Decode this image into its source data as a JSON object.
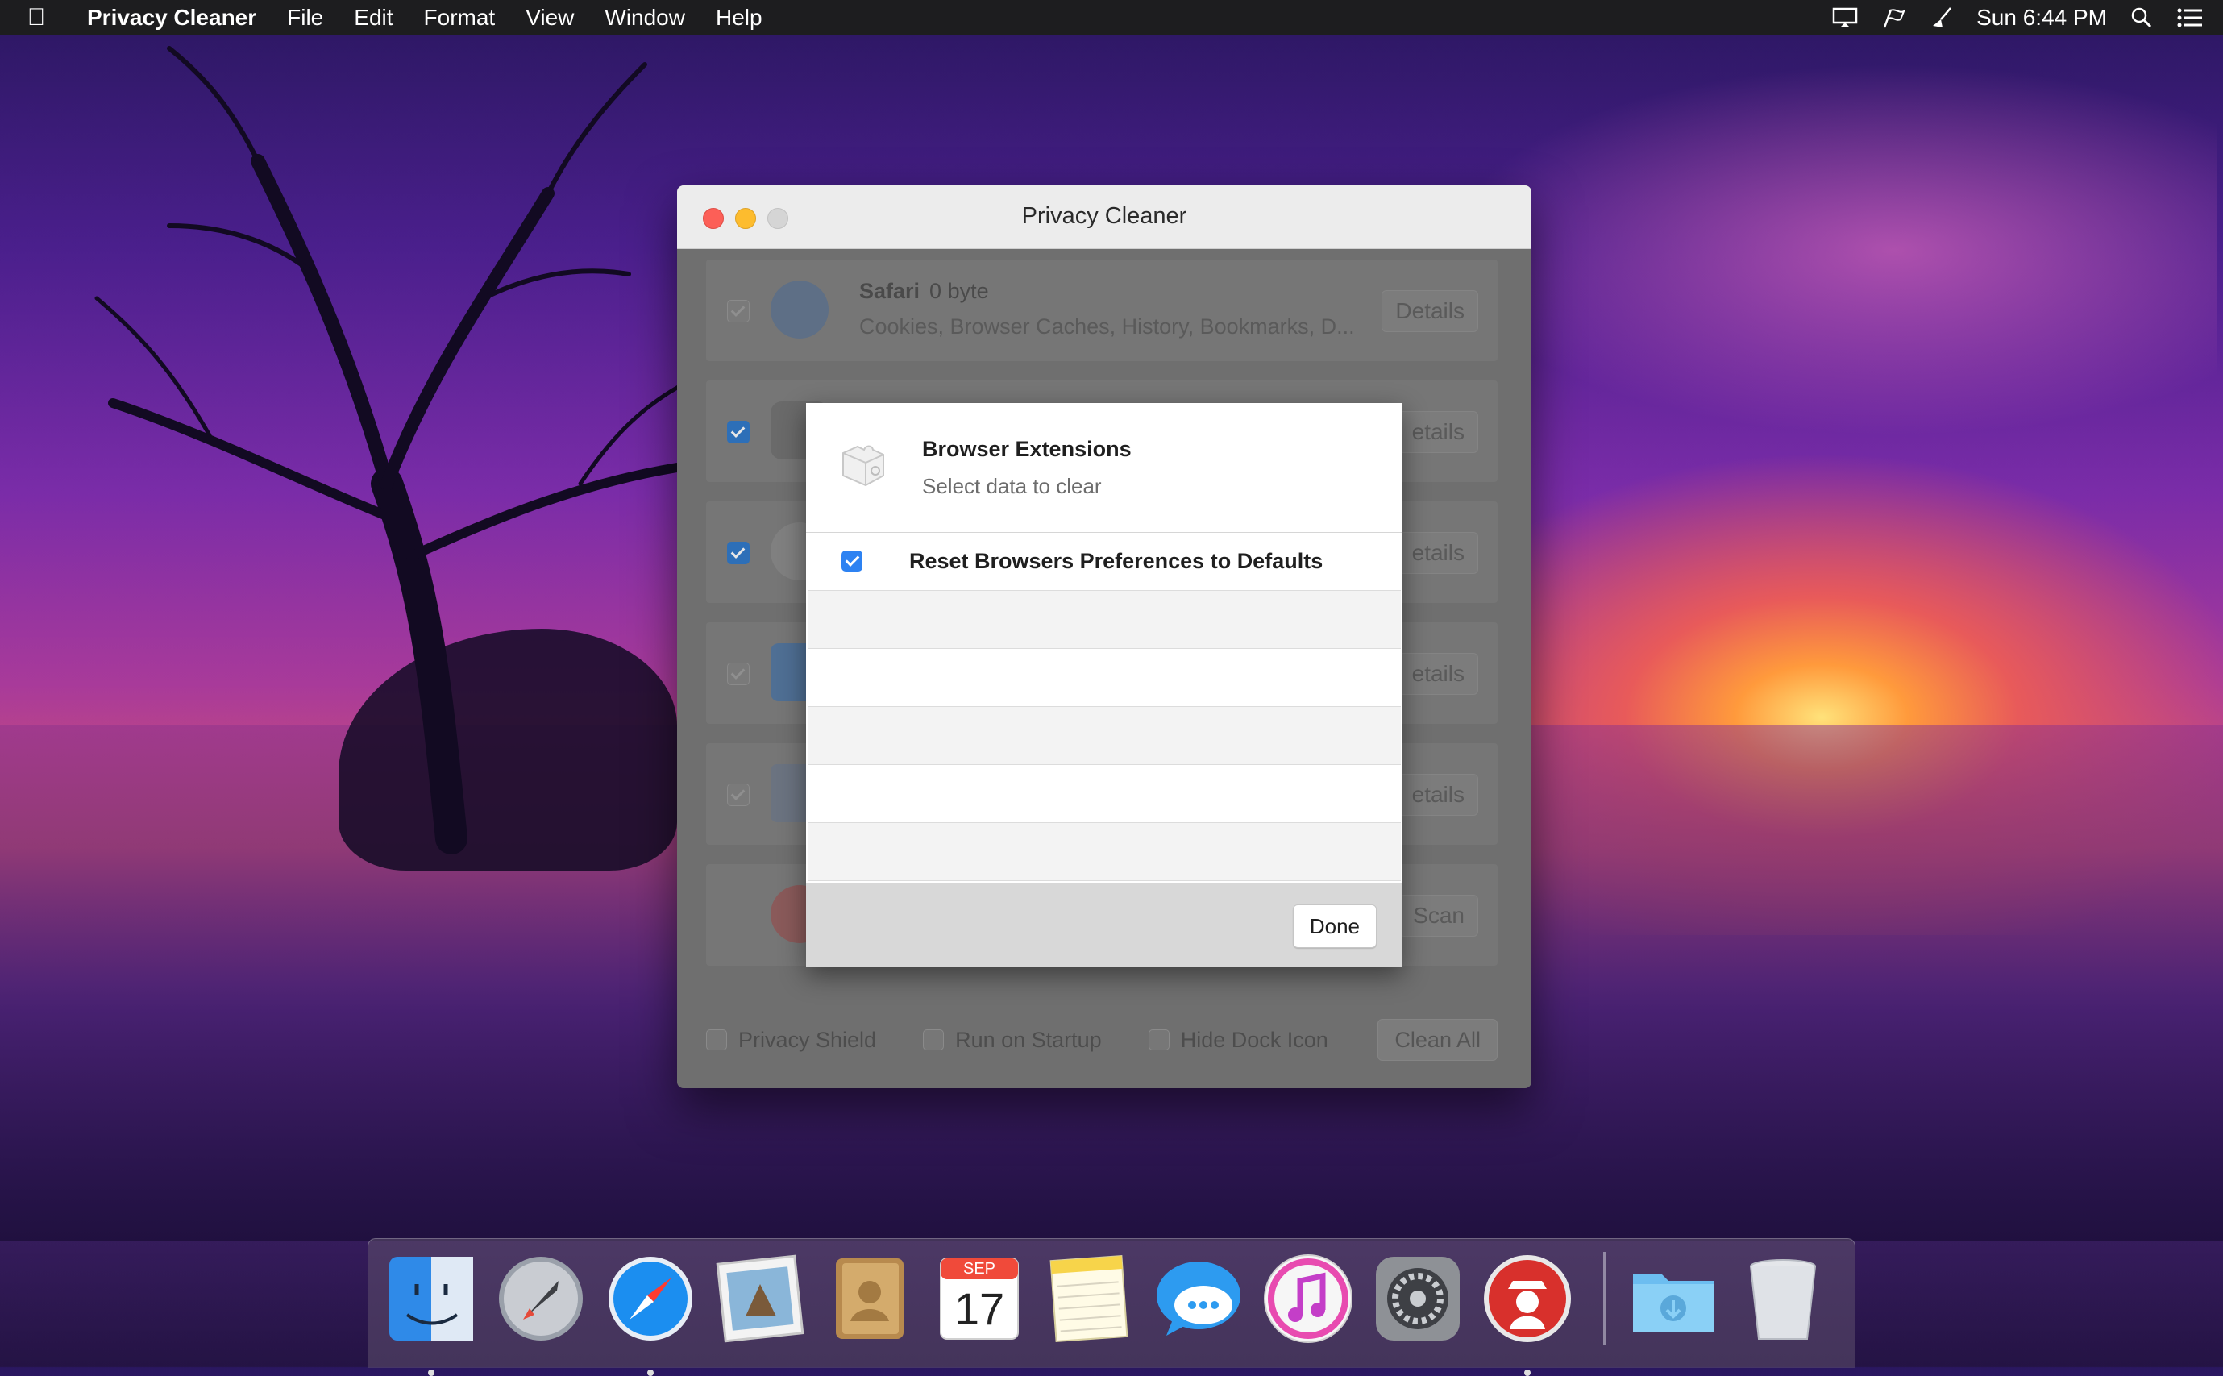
{
  "menubar": {
    "app_name": "Privacy Cleaner",
    "menus": [
      "File",
      "Edit",
      "Format",
      "View",
      "Window",
      "Help"
    ],
    "status_icons": [
      "display-icon",
      "flag-icon",
      "broom-icon"
    ],
    "clock": "Sun 6:44 PM"
  },
  "window": {
    "title": "Privacy Cleaner",
    "rows": [
      {
        "name": "Safari",
        "size": "0 byte",
        "desc": "Cookies, Browser Caches, History, Bookmarks, D...",
        "button": "Details"
      },
      {
        "name": "",
        "size": "",
        "desc": "",
        "button": "etails"
      },
      {
        "name": "",
        "size": "",
        "desc": "",
        "button": "etails"
      },
      {
        "name": "",
        "size": "",
        "desc": "",
        "button": "etails"
      },
      {
        "name": "",
        "size": "",
        "desc": "",
        "button": "etails"
      },
      {
        "name": "",
        "size": "",
        "desc": "",
        "button": "Scan"
      }
    ],
    "options": {
      "privacy_shield": "Privacy Shield",
      "run_on_startup": "Run on Startup",
      "hide_dock_icon": "Hide Dock Icon"
    },
    "clean_all": "Clean All"
  },
  "sheet": {
    "title": "Browser Extensions",
    "subtitle": "Select data to clear",
    "items": [
      {
        "label": "Reset Browsers Preferences to Defaults",
        "checked": true
      }
    ],
    "done": "Done"
  },
  "dock": {
    "items": [
      "finder-icon",
      "launchpad-icon",
      "safari-icon",
      "mail-icon",
      "contacts-icon",
      "calendar-icon",
      "notes-icon",
      "messages-icon",
      "itunes-icon",
      "system-preferences-icon",
      "privacy-cleaner-icon",
      "downloads-folder-icon",
      "trash-icon"
    ],
    "calendar": {
      "month": "SEP",
      "day": "17"
    }
  }
}
